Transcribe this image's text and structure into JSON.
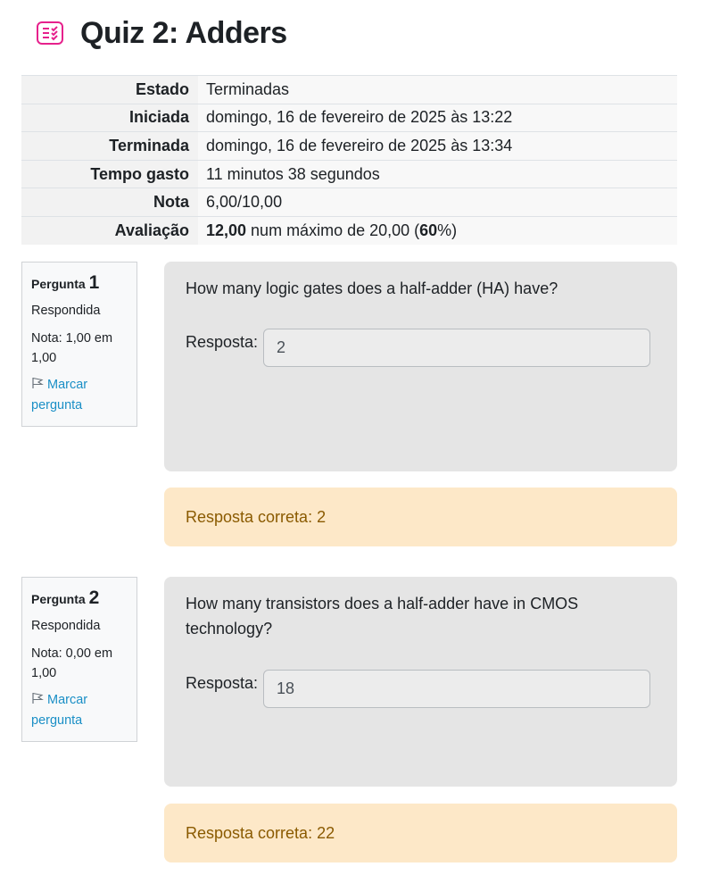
{
  "header": {
    "icon": "quiz-icon",
    "icon_color": "#e6218c",
    "title": "Quiz 2: Adders"
  },
  "summary": {
    "rows": [
      {
        "label": "Estado",
        "value": "Terminadas"
      },
      {
        "label": "Iniciada",
        "value": "domingo, 16 de fevereiro de 2025 às 13:22"
      },
      {
        "label": "Terminada",
        "value": "domingo, 16 de fevereiro de 2025 às 13:34"
      },
      {
        "label": "Tempo gasto",
        "value": "11 minutos 38 segundos"
      },
      {
        "label": "Nota",
        "value": "6,00/10,00"
      }
    ],
    "evaluation": {
      "label": "Avaliação",
      "score": "12,00",
      "middle": " num máximo de 20,00 (",
      "percent": "60",
      "suffix": "%)"
    }
  },
  "questions": [
    {
      "prefix": "Pergunta ",
      "number": "1",
      "state": "Respondida",
      "grade": "Nota: 1,00 em 1,00",
      "flag_label": "Marcar pergunta",
      "text": "How many logic gates does a half-adder (HA) have?",
      "answer_label": "Resposta:",
      "answer_value": "2",
      "correct_answer": "Resposta correta: 2"
    },
    {
      "prefix": "Pergunta ",
      "number": "2",
      "state": "Respondida",
      "grade": "Nota: 0,00 em 1,00",
      "flag_label": "Marcar pergunta",
      "text": "How many transistors does a half-adder have in CMOS technology?",
      "answer_label": "Resposta:",
      "answer_value": "18",
      "correct_answer": "Resposta correta: 22"
    }
  ]
}
